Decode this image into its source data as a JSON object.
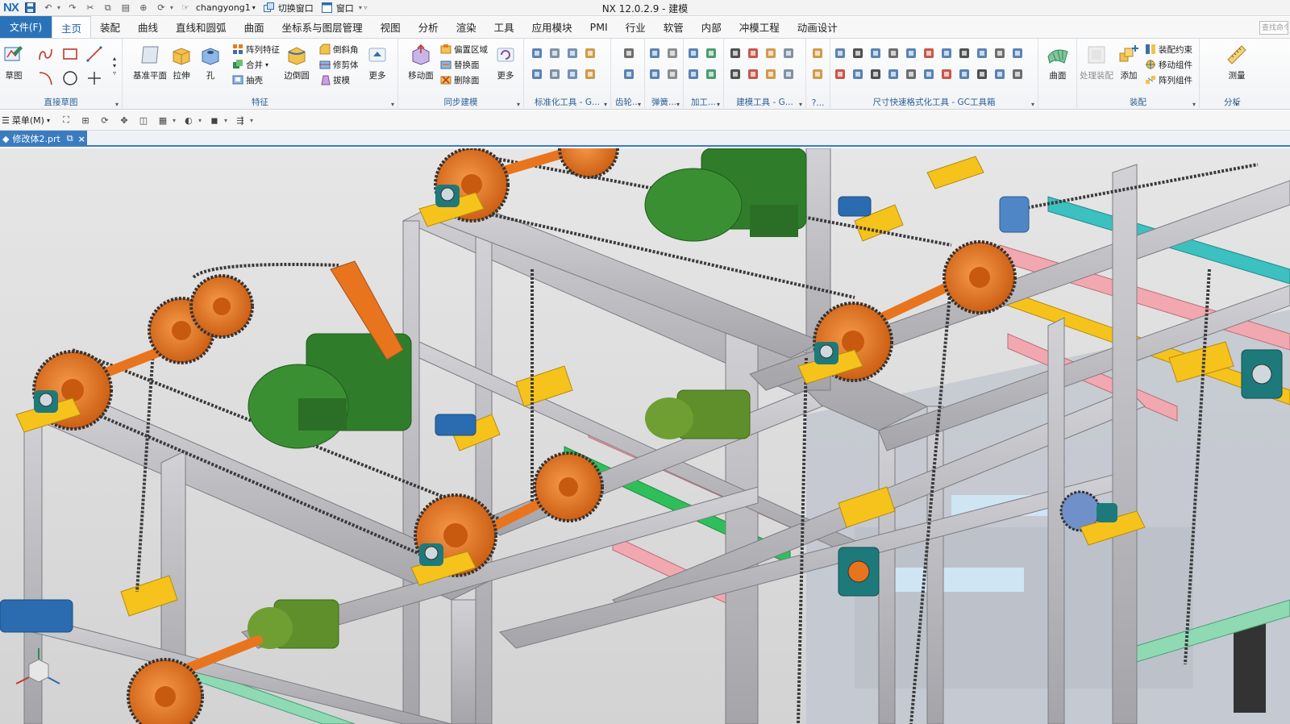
{
  "window": {
    "logo": "NX",
    "title": "NX 12.0.2.9 - 建模",
    "role": "changyong1",
    "switch_window": "切换窗口",
    "window_menu": "窗口"
  },
  "menu": {
    "file": "文件(F)",
    "tabs": [
      "主页",
      "装配",
      "曲线",
      "直线和圆弧",
      "曲面",
      "坐标系与图层管理",
      "视图",
      "分析",
      "渲染",
      "工具",
      "应用模块",
      "PMI",
      "行业",
      "软管",
      "内部",
      "冲模工程",
      "动画设计"
    ],
    "active_tab": "主页",
    "command_search_placeholder": "查找命令"
  },
  "ribbon": {
    "sketch": {
      "sketch_label": "草图",
      "group_label": "直接草图"
    },
    "feature": {
      "datum_plane": "基准平面",
      "extrude": "拉伸",
      "hole": "孔",
      "pattern_feature": "阵列特征",
      "unite": "合并",
      "shell": "抽壳",
      "edge_blend": "边倒圆",
      "chamfer": "倒斜角",
      "trim_body": "修剪体",
      "draft": "拔模",
      "more": "更多",
      "group_label": "特征"
    },
    "sync": {
      "move_face": "移动面",
      "offset_region": "偏置区域",
      "replace_face": "替换面",
      "delete_face": "删除面",
      "more": "更多",
      "group_label": "同步建模"
    },
    "extra_groups": [
      "标准化工具 - G...",
      "齿轮...",
      "弹簧...",
      "加工...",
      "建模工具 - G...",
      "?..."
    ],
    "dimension_group_label": "尺寸快速格式化工具 - GC工具箱",
    "surface": {
      "label": "曲面"
    },
    "assembly": {
      "process_assembly": "处理装配",
      "add": "添加",
      "assembly_constraint": "装配约束",
      "move_component": "移动组件",
      "pattern_component": "阵列组件",
      "group_label": "装配"
    },
    "analysis": {
      "measure": "测量",
      "group_label": "分析"
    }
  },
  "toolstrip": {
    "menu_label": "菜单(M)"
  },
  "document": {
    "tab_name": "修改体2.prt"
  },
  "colors": {
    "accent": "#2b73b8",
    "frame": "#b9b9bd",
    "sprocket": "#e8741e",
    "motor": "#2f7d2a",
    "bracket": "#f5c31c",
    "pink_rail": "#f2a8b0",
    "teal": "#3cc0c0",
    "bearing": "#1e7a7a"
  }
}
